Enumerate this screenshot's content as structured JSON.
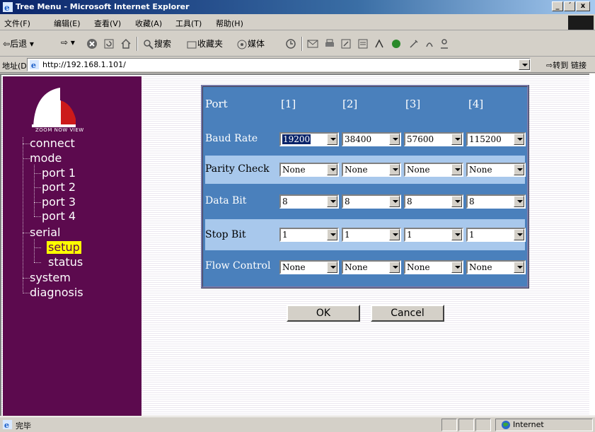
{
  "window": {
    "title": "Tree Menu - Microsoft Internet Explorer",
    "controls": [
      "_",
      "´",
      "x"
    ]
  },
  "menubar": [
    "文件(F)",
    "编辑(E)",
    "查看(V)",
    "收藏(A)",
    "工具(T)",
    "帮助(H)"
  ],
  "toolbar": {
    "back": "后退",
    "search": "搜索",
    "favorites": "收藏夹",
    "media": "媒体"
  },
  "addressbar": {
    "label": "地址(D)",
    "url": "http://192.168.1.101/",
    "go": "转到",
    "links": "链接"
  },
  "sidebar": {
    "logo_text": "ZOOM NOW VIEW",
    "tree": [
      {
        "label": "connect"
      },
      {
        "label": "mode"
      },
      {
        "label": "port 1"
      },
      {
        "label": "port 2"
      },
      {
        "label": "port 3"
      },
      {
        "label": "port 4"
      },
      {
        "label": "serial"
      },
      {
        "label": "setup",
        "selected": true
      },
      {
        "label": "status"
      },
      {
        "label": "system"
      },
      {
        "label": "diagnosis"
      }
    ]
  },
  "port_table": {
    "header": {
      "label": "Port",
      "ports": [
        "[1]",
        "[2]",
        "[3]",
        "[4]"
      ]
    },
    "rows": [
      {
        "label": "Baud Rate",
        "values": [
          "19200",
          "38400",
          "57600",
          "115200"
        ]
      },
      {
        "label": "Parity Check",
        "values": [
          "None",
          "None",
          "None",
          "None"
        ]
      },
      {
        "label": "Data Bit",
        "values": [
          "8",
          "8",
          "8",
          "8"
        ]
      },
      {
        "label": "Stop Bit",
        "values": [
          "1",
          "1",
          "1",
          "1"
        ]
      },
      {
        "label": "Flow Control",
        "values": [
          "None",
          "None",
          "None",
          "None"
        ]
      }
    ]
  },
  "buttons": {
    "ok": "OK",
    "cancel": "Cancel"
  },
  "statusbar": {
    "text": "完毕",
    "zone": "Internet"
  },
  "colors": {
    "sidebar": "#5c0a4e",
    "panel": "#4a80bc",
    "band": "#a8c8ec",
    "selected": "#ffff00"
  }
}
